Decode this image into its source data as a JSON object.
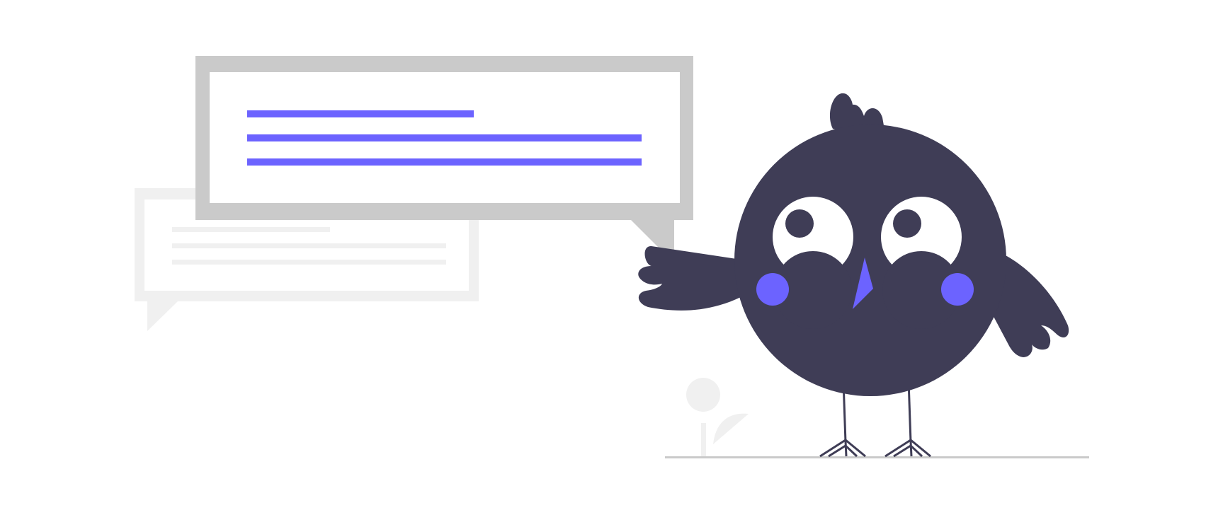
{
  "illustration": {
    "subject": "bird-with-speech-bubbles",
    "colors": {
      "background": "#ffffff",
      "bubble_back": "#f0f0f0",
      "bubble_front_frame": "#cacaca",
      "bubble_inner": "#ffffff",
      "text_line_front": "#6c63ff",
      "text_line_back": "#f0f0f0",
      "bird_body": "#3f3d56",
      "eye_white": "#ffffff",
      "pupil": "#3f3d56",
      "cheek": "#6c63ff",
      "beak": "#6c63ff",
      "ground": "#cacaca",
      "plant": "#f0f0f0"
    },
    "icons": [
      "speech-bubble-icon",
      "speech-bubble-icon",
      "bird-icon",
      "plant-icon"
    ]
  }
}
